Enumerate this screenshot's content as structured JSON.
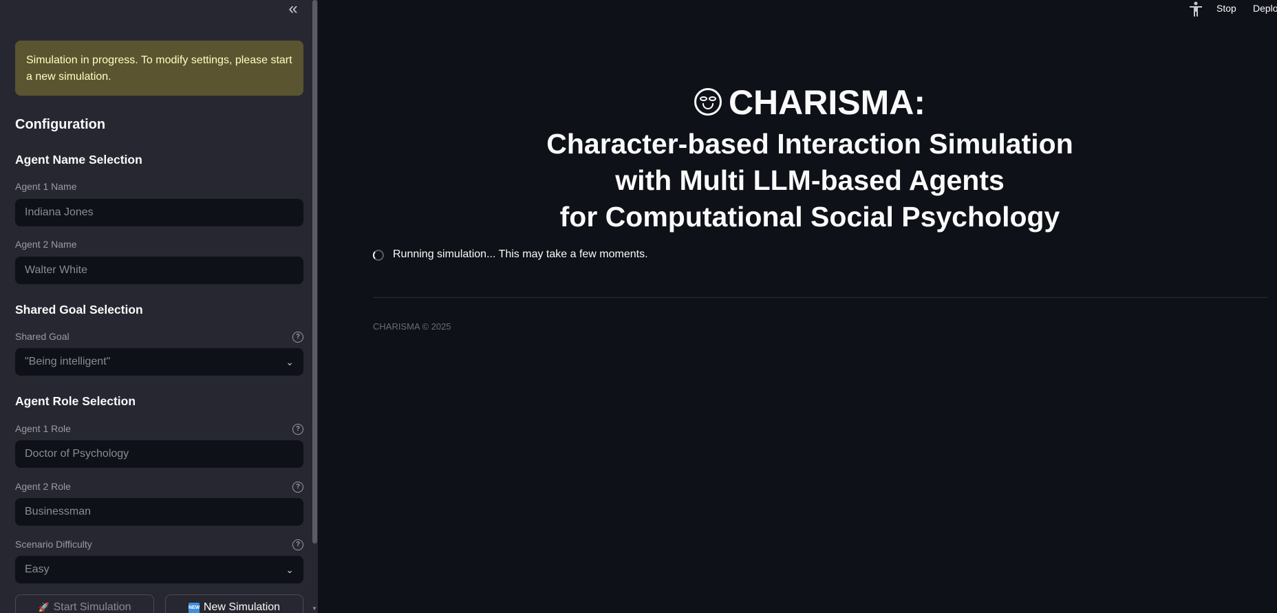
{
  "sidebar": {
    "collapse_label": "«",
    "warning": "Simulation in progress. To modify settings, please start a new simulation.",
    "config_heading": "Configuration",
    "agent_name_heading": "Agent Name Selection",
    "agent1_name_label": "Agent 1 Name",
    "agent1_name_value": "Indiana Jones",
    "agent2_name_label": "Agent 2 Name",
    "agent2_name_value": "Walter White",
    "shared_goal_heading": "Shared Goal Selection",
    "shared_goal_label": "Shared Goal",
    "shared_goal_value": "\"Being intelligent\"",
    "agent_role_heading": "Agent Role Selection",
    "agent1_role_label": "Agent 1 Role",
    "agent1_role_value": "Doctor of Psychology",
    "agent2_role_label": "Agent 2 Role",
    "agent2_role_value": "Businessman",
    "difficulty_label": "Scenario Difficulty",
    "difficulty_value": "Easy",
    "start_button": "Start Simulation",
    "new_button": "New Simulation",
    "new_icon_text": "NEW",
    "help_glyph": "?"
  },
  "toolbar": {
    "stop": "Stop",
    "deploy": "Deploy"
  },
  "main": {
    "title": "CHARISMA:",
    "subtitle_1": "Character-based Interaction Simulation",
    "subtitle_2": "with Multi LLM-based Agents",
    "subtitle_3": "for Computational Social Psychology",
    "running_status": "Running simulation... This may take a few moments.",
    "footer": "CHARISMA © 2025"
  },
  "colors": {
    "background": "#0e1117",
    "sidebar": "#262730",
    "warning_bg": "#5a5530",
    "warning_text": "#ffffc2"
  }
}
